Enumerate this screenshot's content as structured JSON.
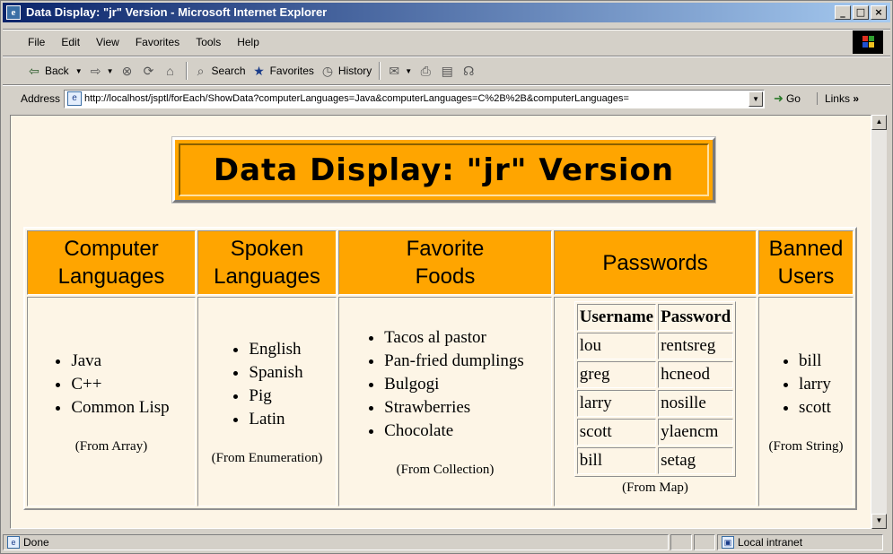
{
  "window": {
    "title": "Data Display: \"jr\" Version - Microsoft Internet Explorer",
    "controls": [
      "_",
      "□",
      "×"
    ]
  },
  "menu": [
    "File",
    "Edit",
    "View",
    "Favorites",
    "Tools",
    "Help"
  ],
  "toolbar": {
    "back": "Back",
    "search": "Search",
    "favorites": "Favorites",
    "history": "History"
  },
  "address": {
    "label": "Address",
    "url": "http://localhost/jsptl/forEach/ShowData?computerLanguages=Java&computerLanguages=C%2B%2B&computerLanguages=",
    "go": "Go",
    "links": "Links"
  },
  "page": {
    "title": "Data Display: \"jr\" Version",
    "columns": [
      {
        "header_lines": [
          "Computer",
          "Languages"
        ],
        "items": [
          "Java",
          "C++",
          "Common Lisp"
        ],
        "source": "(From Array)"
      },
      {
        "header_lines": [
          "Spoken",
          "Languages"
        ],
        "items": [
          "English",
          "Spanish",
          "Pig",
          "Latin"
        ],
        "source": "(From Enumeration)"
      },
      {
        "header_lines": [
          "Favorite",
          "Foods"
        ],
        "items": [
          "Tacos al pastor",
          "Pan-fried dumplings",
          "Bulgogi",
          "Strawberries",
          "Chocolate"
        ],
        "source": "(From Collection)"
      },
      {
        "header_lines": [
          "Passwords"
        ],
        "source": "(From Map)"
      },
      {
        "header_lines": [
          "Banned",
          "Users"
        ],
        "items": [
          "bill",
          "larry",
          "scott"
        ],
        "source": "(From String)"
      }
    ],
    "passwords": {
      "headers": [
        "Username",
        "Password"
      ],
      "rows": [
        [
          "lou",
          "rentsreg"
        ],
        [
          "greg",
          "hcneod"
        ],
        [
          "larry",
          "nosille"
        ],
        [
          "scott",
          "ylaencm"
        ],
        [
          "bill",
          "setag"
        ]
      ]
    }
  },
  "status": {
    "text": "Done",
    "zone": "Local intranet"
  },
  "colors": {
    "header_bg": "#ffa500",
    "page_bg": "#fdf5e6",
    "chrome": "#d4d0c8"
  }
}
